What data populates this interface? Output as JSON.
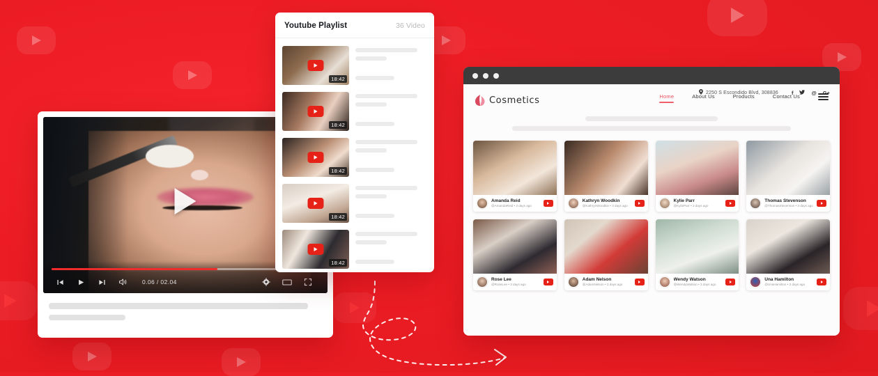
{
  "background": {
    "accent_red": "#ec1c24",
    "watermark_icon": "youtube-play-badge"
  },
  "arrow": {
    "name": "dashed-curved-arrow"
  },
  "player": {
    "play_overlay_icon": "play-triangle-icon",
    "current_time": "0.06 / 02.04",
    "controls": [
      {
        "icon": "previous-track-icon",
        "glyph": "⏮"
      },
      {
        "icon": "play-icon",
        "glyph": "▶"
      },
      {
        "icon": "next-track-icon",
        "glyph": "⏭"
      },
      {
        "icon": "volume-icon",
        "glyph": "🔊"
      }
    ],
    "right_controls": [
      {
        "icon": "settings-gear-icon",
        "glyph": "⚙"
      },
      {
        "icon": "theater-mode-icon",
        "glyph": "▭"
      },
      {
        "icon": "fullscreen-icon",
        "glyph": "⛶"
      }
    ],
    "progress_percent": 62
  },
  "playlist": {
    "title": "Youtube Playlist",
    "count": "36 Video",
    "items": [
      {
        "duration": "18:42"
      },
      {
        "duration": "18:42"
      },
      {
        "duration": "18:42"
      },
      {
        "duration": "18:42"
      },
      {
        "duration": "18:42"
      }
    ]
  },
  "site": {
    "window_dots": 3,
    "address": "2250 S Escondido Blvd, 308836",
    "location_icon": "location-pin-icon",
    "socials": [
      {
        "name": "facebook-icon",
        "glyph": "f"
      },
      {
        "name": "twitter-icon",
        "glyph": "ᴠ"
      },
      {
        "name": "instagram-icon",
        "glyph": "@"
      },
      {
        "name": "google-plus-icon",
        "glyph": "G+"
      }
    ],
    "brand": "Cosmetics",
    "logo_icon": "cosmetics-droplet-logo",
    "nav": [
      {
        "label": "Home",
        "active": true
      },
      {
        "label": "About Us",
        "active": false
      },
      {
        "label": "Products",
        "active": false
      },
      {
        "label": "Contact Us",
        "active": false
      }
    ],
    "menu_icon": "hamburger-menu-icon",
    "accent": "#ef5f6b",
    "cards": [
      {
        "name": "Amanda Reid",
        "handle": "@AmandaReid • 3 days ago"
      },
      {
        "name": "Kathryn Woodkin",
        "handle": "@KathrynWoodkin • 3 days ago"
      },
      {
        "name": "Kylie Parr",
        "handle": "@KylieParr • 3 days ago"
      },
      {
        "name": "Thomas Stevenson",
        "handle": "@ThomasStevenson • 3 days ago"
      },
      {
        "name": "Rose Lee",
        "handle": "@RoseLee • 3 days ago"
      },
      {
        "name": "Adam Nelson",
        "handle": "@AdamNelson • 3 days ago"
      },
      {
        "name": "Wendy Watson",
        "handle": "@WendyWatson • 3 days ago"
      },
      {
        "name": "Una Hamilton",
        "handle": "@UnaHamilton • 3 days ago"
      }
    ]
  }
}
